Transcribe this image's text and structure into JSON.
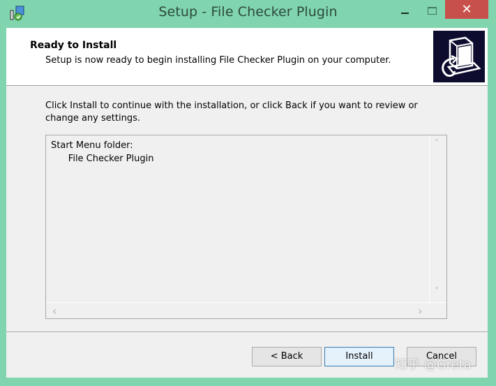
{
  "window": {
    "title": "Setup - File Checker Plugin",
    "icons": {
      "app": "setup-app-icon",
      "minimize": "minimize-icon",
      "maximize": "maximize-icon",
      "close": "close-icon"
    },
    "close_glyph": "✕",
    "colors": {
      "frame": "#80d4ae",
      "close": "#c7504a"
    }
  },
  "header": {
    "title": "Ready to Install",
    "subtitle": "Setup is now ready to begin installing File Checker Plugin on your computer.",
    "logo_icon": "computer-install-icon"
  },
  "body": {
    "description": "Click Install to continue with the installation, or click Back if you want to review or change any settings.",
    "memo": {
      "lines": "Start Menu folder:\n      File Checker Plugin",
      "scroll_up": "˄",
      "scroll_down": "˅",
      "scroll_left": "‹",
      "scroll_right": "›"
    }
  },
  "footer": {
    "back_label": "< Back",
    "install_label": "Install",
    "cancel_label": "Cancel"
  },
  "watermark": "知乎 @Greta"
}
